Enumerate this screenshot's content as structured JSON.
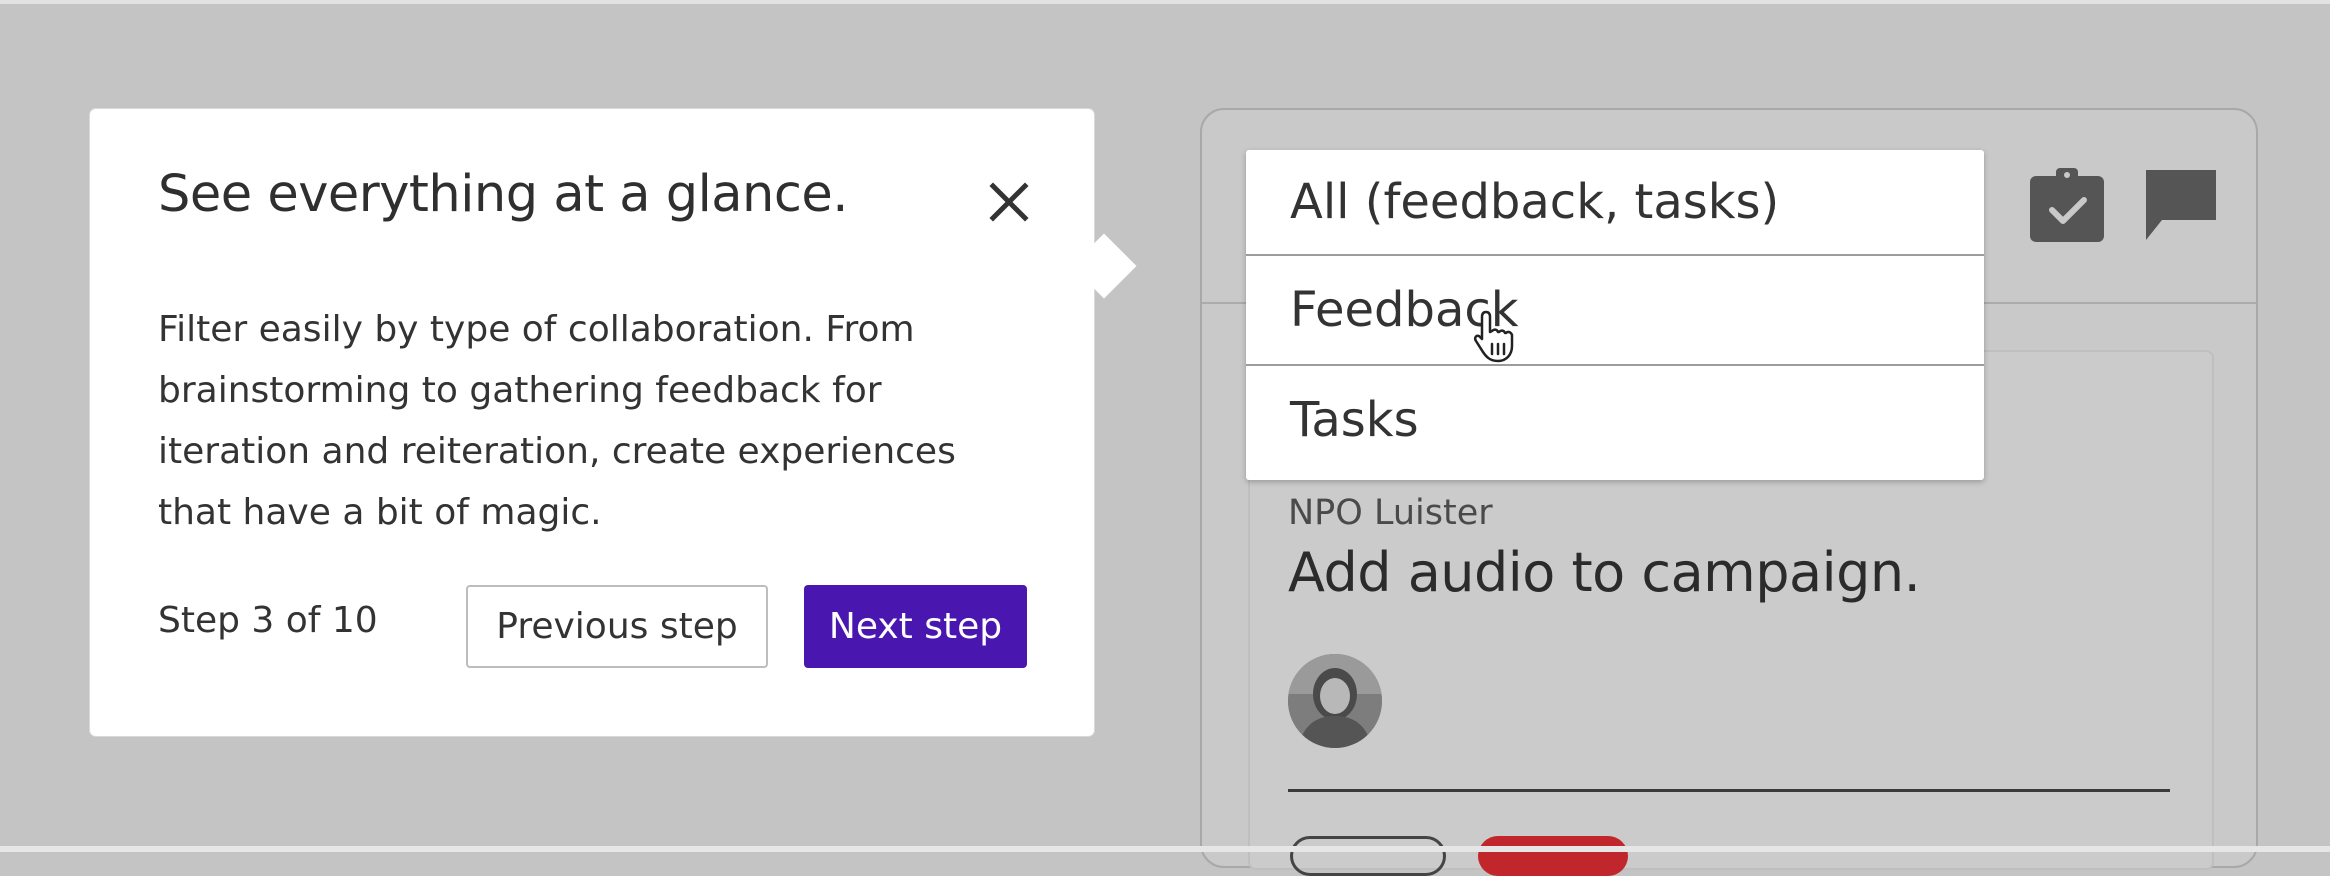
{
  "tour": {
    "title": "See everything at a glance.",
    "body": "Filter easily by type of collaboration. From brainstorming to gathering feedback for iteration and reiteration, create experiences that have a bit of magic.",
    "step": "Step 3 of 10",
    "previous_label": "Previous step",
    "next_label": "Next step",
    "close_icon": "close-icon"
  },
  "dropdown": {
    "items": [
      {
        "label": "All (feedback, tasks)"
      },
      {
        "label": "Feedback"
      },
      {
        "label": "Tasks"
      }
    ],
    "hovered": "Feedback"
  },
  "panel": {
    "icons": [
      "task-clipboard-icon",
      "chat-bubble-icon"
    ],
    "card": {
      "organization": "NPO Luister",
      "title": "Add audio to campaign."
    }
  },
  "colors": {
    "accent": "#4a16b0",
    "overlay_background": "#c4c4c4",
    "tag_red": "#c0262b"
  }
}
